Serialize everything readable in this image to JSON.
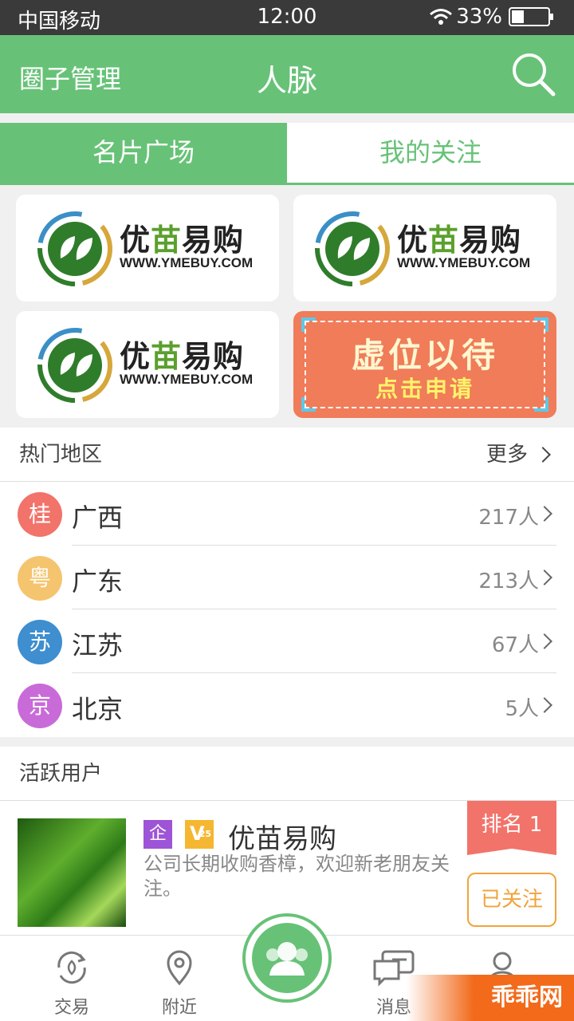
{
  "status_bar": {
    "carrier": "中国移动",
    "time": "12:00",
    "battery": "33%",
    "battery_level": 0.33
  },
  "header": {
    "left_action": "圈子管理",
    "title": "人脉"
  },
  "tabs": [
    {
      "label": "名片广场",
      "active": true
    },
    {
      "label": "我的关注",
      "active": false
    }
  ],
  "cards": [
    {
      "name_part1": "优",
      "name_part2": "苗",
      "name_part3": "易购",
      "url": "WWW.YMEBUY.COM"
    },
    {
      "name_part1": "优",
      "name_part2": "苗",
      "name_part3": "易购",
      "url": "WWW.YMEBUY.COM"
    },
    {
      "name_part1": "优",
      "name_part2": "苗",
      "name_part3": "易购",
      "url": "WWW.YMEBUY.COM"
    }
  ],
  "promo": {
    "line1": "虚位以待",
    "line2": "点击申请"
  },
  "hot_regions": {
    "title": "热门地区",
    "more": "更多",
    "items": [
      {
        "badge": "桂",
        "name": "广西",
        "count": "217人",
        "color": "#f2736a"
      },
      {
        "badge": "粤",
        "name": "广东",
        "count": "213人",
        "color": "#f5c46e"
      },
      {
        "badge": "苏",
        "name": "江苏",
        "count": "67人",
        "color": "#3e8ed0"
      },
      {
        "badge": "京",
        "name": "北京",
        "count": "5人",
        "color": "#c86bd8"
      }
    ]
  },
  "active_users": {
    "title": "活跃用户",
    "user": {
      "tag_enterprise": "企",
      "tag_v": "V",
      "tag_v_level": "25",
      "name": "优苗易购",
      "description": "公司长期收购香樟，欢迎新老朋友关注。",
      "rank": "排名 1",
      "follow_label": "已关注"
    }
  },
  "tabbar": {
    "items": [
      {
        "label": "交易",
        "icon": "trade-icon"
      },
      {
        "label": "附近",
        "icon": "location-icon"
      },
      {
        "label": "",
        "icon": "contacts-icon"
      },
      {
        "label": "消息",
        "icon": "message-icon"
      },
      {
        "label": "",
        "icon": "profile-icon"
      }
    ]
  },
  "watermark": "乖乖网",
  "colors": {
    "brand_green": "#67c277",
    "rank_red": "#f2736a",
    "follow_orange": "#f2a33a",
    "promo_orange": "#f07c59"
  }
}
